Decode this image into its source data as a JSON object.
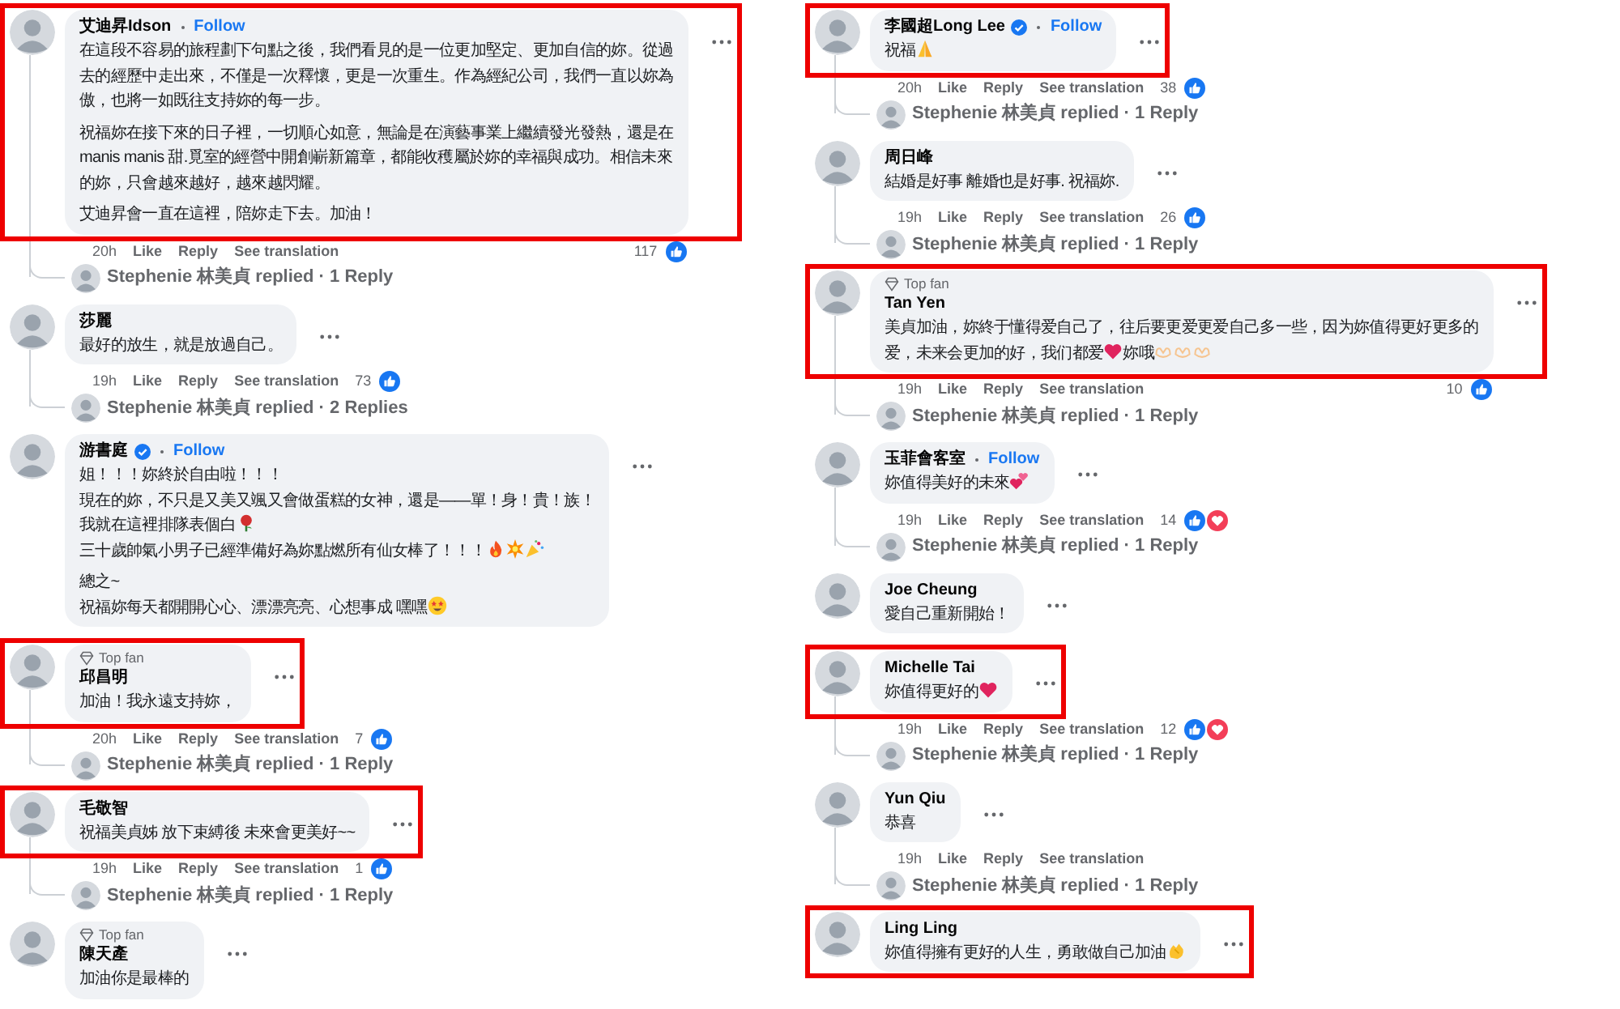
{
  "columns": [
    {
      "comments": [
        {
          "name": "艾迪昇Idson",
          "follow": "Follow",
          "highlighted": true,
          "paragraphs": [
            [
              [
                {
                  "kind": "text",
                  "text": "在這段不容易的旅程劃下句點之後，我們看見的是一位更加堅定、更加自信的妳。從過"
                }
              ],
              [
                {
                  "kind": "text",
                  "text": "去的經歷中走出來，不僅是一次釋懷，更是一次重生。作為經紀公司，我們一直以妳為"
                }
              ],
              [
                {
                  "kind": "text",
                  "text": "傲，也將一如既往支持妳的每一步。"
                }
              ]
            ],
            [
              [
                {
                  "kind": "text",
                  "text": "祝福妳在接下來的日子裡，一切順心如意，無論是在演藝事業上繼續發光發熱，還是在"
                }
              ],
              [
                {
                  "kind": "text",
                  "text": "manis manis 甜.覓室的經營中開創嶄新篇章，都能收穫屬於妳的幸福與成功。相信未來"
                }
              ],
              [
                {
                  "kind": "text",
                  "text": "的妳，只會越來越好，越來越閃耀。"
                }
              ]
            ],
            [
              [
                {
                  "kind": "text",
                  "text": "艾迪昇會一直在這裡，陪妳走下去。加油！"
                }
              ]
            ]
          ],
          "meta": {
            "time": "20h",
            "actions": [
              "Like",
              "Reply",
              "See translation"
            ],
            "count": "117",
            "reactions": [
              {
                "kind": "like"
              }
            ]
          },
          "reply_summary": "Stephenie 林美貞 replied · 1 Reply"
        },
        {
          "name": "莎麗",
          "highlighted": false,
          "paragraphs": [
            [
              [
                {
                  "kind": "text",
                  "text": "最好的放生，就是放過自己。"
                }
              ]
            ]
          ],
          "meta": {
            "time": "19h",
            "actions": [
              "Like",
              "Reply",
              "See translation"
            ],
            "count": "73",
            "reactions": [
              {
                "kind": "like"
              }
            ]
          },
          "reply_summary": "Stephenie 林美貞 replied · 2 Replies"
        },
        {
          "name": "游書庭",
          "verified": true,
          "follow": "Follow",
          "highlighted": false,
          "paragraphs": [
            [
              [
                {
                  "kind": "text",
                  "text": "姐！！！妳終於自由啦！！！"
                }
              ],
              [
                {
                  "kind": "text",
                  "text": "現在的妳，不只是又美又颯又會做蛋糕的女神，還是——單！身！貴！族！"
                }
              ],
              [
                {
                  "kind": "text",
                  "text": "我就在這裡排隊表個白"
                },
                {
                  "kind": "rose"
                }
              ],
              [
                {
                  "kind": "text",
                  "text": "三十歲帥氣小男子已經準備好為妳點燃所有仙女棒了！！！"
                },
                {
                  "kind": "fire"
                },
                {
                  "kind": "burst"
                },
                {
                  "kind": "popper"
                }
              ]
            ],
            [
              [
                {
                  "kind": "text",
                  "text": "總之~"
                }
              ],
              [
                {
                  "kind": "text",
                  "text": "祝福妳每天都開開心心、漂漂亮亮、心想事成 嘿嘿"
                },
                {
                  "kind": "star_eyes"
                }
              ]
            ]
          ]
        },
        {
          "badge": "Top fan",
          "name": "邱昌明",
          "highlighted": true,
          "paragraphs": [
            [
              [
                {
                  "kind": "text",
                  "text": "加油！我永遠支持妳，"
                }
              ]
            ]
          ],
          "meta": {
            "time": "20h",
            "actions": [
              "Like",
              "Reply",
              "See translation"
            ],
            "count": "7",
            "reactions": [
              {
                "kind": "like"
              }
            ]
          },
          "reply_summary": "Stephenie 林美貞 replied · 1 Reply"
        },
        {
          "name": "毛敬智",
          "highlighted": true,
          "paragraphs": [
            [
              [
                {
                  "kind": "text",
                  "text": "祝福美貞姊 放下束縛後 未來會更美好~~"
                }
              ]
            ]
          ],
          "meta": {
            "time": "19h",
            "actions": [
              "Like",
              "Reply",
              "See translation"
            ],
            "count": "1",
            "reactions": [
              {
                "kind": "like"
              }
            ]
          },
          "reply_summary": "Stephenie 林美貞 replied · 1 Reply"
        },
        {
          "badge": "Top fan",
          "name": "陳天產",
          "highlighted": false,
          "paragraphs": [
            [
              [
                {
                  "kind": "text",
                  "text": "加油你是最棒的"
                }
              ]
            ]
          ]
        }
      ]
    },
    {
      "comments": [
        {
          "name": "李國超Long Lee",
          "verified": true,
          "follow": "Follow",
          "highlighted": true,
          "paragraphs": [
            [
              [
                {
                  "kind": "text",
                  "text": "祝福"
                },
                {
                  "kind": "pray"
                }
              ]
            ]
          ],
          "meta": {
            "time": "20h",
            "actions": [
              "Like",
              "Reply",
              "See translation"
            ],
            "count": "38",
            "reactions": [
              {
                "kind": "like"
              }
            ]
          },
          "reply_summary": "Stephenie 林美貞 replied · 1 Reply"
        },
        {
          "name": "周日峰",
          "highlighted": false,
          "paragraphs": [
            [
              [
                {
                  "kind": "text",
                  "text": "結婚是好事 離婚也是好事. 祝福妳."
                }
              ]
            ]
          ],
          "meta": {
            "time": "19h",
            "actions": [
              "Like",
              "Reply",
              "See translation"
            ],
            "count": "26",
            "reactions": [
              {
                "kind": "like"
              }
            ]
          },
          "reply_summary": "Stephenie 林美貞 replied · 1 Reply"
        },
        {
          "badge": "Top fan",
          "name": "Tan Yen",
          "highlighted": true,
          "paragraphs": [
            [
              [
                {
                  "kind": "text",
                  "text": "美貞加油，妳終于懂得爱自己了，往后要更爱更爱自己多一些，因为妳值得更好更多的"
                }
              ],
              [
                {
                  "kind": "text",
                  "text": "爱，未来会更加的好，我们都爱"
                },
                {
                  "kind": "heart"
                },
                {
                  "kind": "text",
                  "text": "妳哦"
                },
                {
                  "kind": "hands"
                },
                {
                  "kind": "hands"
                },
                {
                  "kind": "hands"
                }
              ]
            ]
          ],
          "meta": {
            "time": "19h",
            "actions": [
              "Like",
              "Reply",
              "See translation"
            ],
            "count": "10",
            "reactions": [
              {
                "kind": "like"
              }
            ]
          },
          "reply_summary": "Stephenie 林美貞 replied · 1 Reply"
        },
        {
          "name": "玉菲會客室",
          "follow": "Follow",
          "highlighted": false,
          "paragraphs": [
            [
              [
                {
                  "kind": "text",
                  "text": "妳值得美好的未來"
                },
                {
                  "kind": "hearts"
                }
              ]
            ]
          ],
          "meta": {
            "time": "19h",
            "actions": [
              "Like",
              "Reply",
              "See translation"
            ],
            "count": "14",
            "reactions": [
              {
                "kind": "like"
              },
              {
                "kind": "love"
              }
            ]
          },
          "reply_summary": "Stephenie 林美貞 replied · 1 Reply"
        },
        {
          "name": "Joe Cheung",
          "highlighted": false,
          "paragraphs": [
            [
              [
                {
                  "kind": "text",
                  "text": "愛自己重新開始！"
                }
              ]
            ]
          ]
        },
        {
          "name": "Michelle Tai",
          "highlighted": true,
          "paragraphs": [
            [
              [
                {
                  "kind": "text",
                  "text": "妳值得更好的"
                },
                {
                  "kind": "heart"
                }
              ]
            ]
          ],
          "meta": {
            "time": "19h",
            "actions": [
              "Like",
              "Reply",
              "See translation"
            ],
            "count": "12",
            "reactions": [
              {
                "kind": "like"
              },
              {
                "kind": "love"
              }
            ]
          },
          "reply_summary": "Stephenie 林美貞 replied · 1 Reply"
        },
        {
          "name": "Yun Qiu",
          "highlighted": false,
          "paragraphs": [
            [
              [
                {
                  "kind": "text",
                  "text": "恭喜"
                }
              ]
            ]
          ],
          "meta": {
            "time": "19h",
            "actions": [
              "Like",
              "Reply",
              "See translation"
            ]
          },
          "reply_summary": "Stephenie 林美貞 replied · 1 Reply"
        },
        {
          "name": "Ling Ling",
          "highlighted": true,
          "paragraphs": [
            [
              [
                {
                  "kind": "text",
                  "text": "妳值得擁有更好的人生，勇敢做自己加油"
                },
                {
                  "kind": "clap"
                }
              ]
            ]
          ]
        }
      ]
    }
  ]
}
